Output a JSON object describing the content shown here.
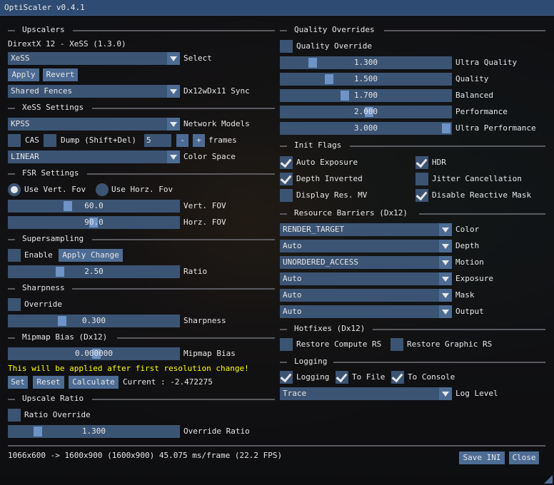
{
  "window": {
    "title": "OptiScaler v0.4.1"
  },
  "upscalers": {
    "header": "Upscalers",
    "api_label": "DirextX 12 - XeSS (1.3.0)",
    "select_value": "XeSS",
    "select_label": "Select",
    "apply": "Apply",
    "revert": "Revert",
    "sync_value": "Shared Fences",
    "sync_label": "Dx12wDx11 Sync"
  },
  "xess": {
    "header": "XeSS Settings",
    "model_value": "KPSS",
    "model_label": "Network Models",
    "cas_label": "CAS",
    "dump_label": "Dump (Shift+Del)",
    "frames_value": "5",
    "minus": "-",
    "plus": "+",
    "frames_label": "frames",
    "color_space_value": "LINEAR",
    "color_space_label": "Color Space"
  },
  "fsr": {
    "header": "FSR Settings",
    "vert_label": "Use Vert. Fov",
    "horz_label": "Use Horz. Fov",
    "vfov_value": "60.0",
    "vfov_label": "Vert. FOV",
    "hfov_value": "90.0",
    "hfov_label": "Horz. FOV"
  },
  "supersampling": {
    "header": "Supersampling",
    "enable_label": "Enable",
    "apply_change": "Apply Change",
    "ratio_value": "2.50",
    "ratio_label": "Ratio"
  },
  "sharpness": {
    "header": "Sharpness",
    "override_label": "Override",
    "value": "0.300",
    "label": "Sharpness"
  },
  "mipmap": {
    "header": "Mipmap Bias (Dx12)",
    "value": "0.000000",
    "label": "Mipmap Bias",
    "warning": "This will be applied after first resolution change!",
    "set": "Set",
    "reset": "Reset",
    "calculate": "Calculate",
    "current": "Current : -2.472275"
  },
  "upscale_ratio": {
    "header": "Upscale Ratio",
    "override_label": "Ratio Override",
    "value": "1.300",
    "label": "Override Ratio"
  },
  "quality": {
    "header": "Quality Overrides",
    "override_label": "Quality Override",
    "rows": [
      {
        "value": "1.300",
        "label": "Ultra Quality",
        "level": 0.17
      },
      {
        "value": "1.500",
        "label": "Quality",
        "level": 0.27
      },
      {
        "value": "1.700",
        "label": "Balanced",
        "level": 0.37
      },
      {
        "value": "2.000",
        "label": "Performance",
        "level": 0.52
      },
      {
        "value": "3.000",
        "label": "Ultra Performance",
        "level": 1.0
      }
    ]
  },
  "init_flags": {
    "header": "Init Flags",
    "auto_exposure": "Auto Exposure",
    "hdr": "HDR",
    "depth_inverted": "Depth Inverted",
    "jitter": "Jitter Cancellation",
    "display_res": "Display Res. MV",
    "disable_reactive": "Disable Reactive Mask"
  },
  "barriers": {
    "header": "Resource Barriers (Dx12)",
    "rows": [
      {
        "value": "RENDER_TARGET",
        "label": "Color"
      },
      {
        "value": "Auto",
        "label": "Depth"
      },
      {
        "value": "UNORDERED_ACCESS",
        "label": "Motion"
      },
      {
        "value": "Auto",
        "label": "Exposure"
      },
      {
        "value": "Auto",
        "label": "Mask"
      },
      {
        "value": "Auto",
        "label": "Output"
      }
    ]
  },
  "hotfixes": {
    "header": "Hotfixes (Dx12)",
    "compute": "Restore Compute RS",
    "graphic": "Restore Graphic RS"
  },
  "logging": {
    "header": "Logging",
    "logging": "Logging",
    "to_file": "To File",
    "to_console": "To Console",
    "level_value": "Trace",
    "level_label": "Log Level"
  },
  "footer": {
    "stats": "1066x600 -> 1600x900 (1600x900) 45.075 ms/frame (22.2 FPS)",
    "save": "Save INI",
    "close": "Close"
  }
}
